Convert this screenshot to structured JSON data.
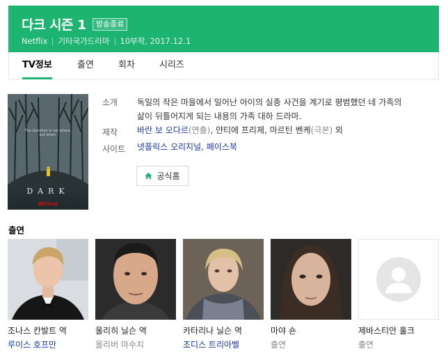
{
  "header": {
    "title": "다크 시즌 1",
    "badge": "방송종료",
    "meta": [
      "Netflix",
      "기타국가드라마",
      "10부작, 2017.12.1"
    ],
    "color": "#1db371"
  },
  "tabs": [
    "TV정보",
    "출연",
    "회차",
    "시리즈"
  ],
  "poster": {
    "tagline_line1": "The Question is not where,",
    "tagline_line2": "but when.",
    "title": "DARK",
    "brand": "NETFLIX"
  },
  "info": {
    "synopsis_label": "소개",
    "synopsis_line1": "독일의 작은 마을에서 일어난 아이의 실종 사건을 계기로 평범했던 네 가족의",
    "synopsis_line2": "삶이 뒤틀어지게 되는 내용의 가족 대하 드라마.",
    "production_label": "제작",
    "director": "바란 보 오다르",
    "director_role": "(연출)",
    "production_rest_before": ", 얀티에 프리제, 마르틴 벤케",
    "writer_role": "(극본)",
    "production_suffix": " 외",
    "site_label": "사이트",
    "site_links": "넷플릭스 오리지널, 페이스북",
    "home_button": "공식홈"
  },
  "cast_section": {
    "title": "출연",
    "members": [
      {
        "role": "조나스 칸발트 역",
        "actor": "루이스 호프만"
      },
      {
        "role": "울리히 닐슨 역",
        "actor": "올리버 마수치"
      },
      {
        "role": "카타리나 닐슨 역",
        "actor": "조디스 트리아벨"
      },
      {
        "role": "마야 숀",
        "actor": "출연"
      },
      {
        "role": "제바스티안 훌크",
        "actor": "출연"
      }
    ]
  }
}
